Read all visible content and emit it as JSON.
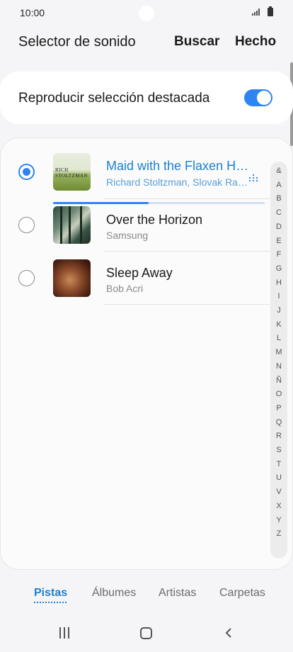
{
  "status_bar": {
    "time": "10:00"
  },
  "header": {
    "title": "Selector de sonido",
    "search_label": "Buscar",
    "done_label": "Hecho"
  },
  "highlight": {
    "label": "Reproducir selección destacada",
    "enabled": true
  },
  "tracks": [
    {
      "title": "Maid with the Flaxen H…",
      "artist": "Richard Stoltzman, Slovak Ra…",
      "selected": true,
      "playing": true,
      "progress_percent": 45,
      "cover_text": "RICH STOLTZMAN"
    },
    {
      "title": "Over the Horizon",
      "artist": "Samsung",
      "selected": false,
      "playing": false
    },
    {
      "title": "Sleep Away",
      "artist": "Bob Acri",
      "selected": false,
      "playing": false
    }
  ],
  "index_letters": [
    "&",
    "A",
    "B",
    "C",
    "D",
    "E",
    "F",
    "G",
    "H",
    "I",
    "J",
    "K",
    "L",
    "M",
    "N",
    "Ñ",
    "O",
    "P",
    "Q",
    "R",
    "S",
    "T",
    "U",
    "V",
    "X",
    "Y",
    "Z"
  ],
  "tabs": [
    {
      "label": "Pistas",
      "active": true
    },
    {
      "label": "Álbumes",
      "active": false
    },
    {
      "label": "Artistas",
      "active": false
    },
    {
      "label": "Carpetas",
      "active": false
    }
  ],
  "colors": {
    "accent": "#2f84f4",
    "active_text": "#1d7fd0"
  },
  "icons": {
    "signal": "signal-icon",
    "battery": "battery-icon",
    "playing": "equalizer-icon",
    "recent": "recent-apps-icon",
    "home": "home-icon",
    "back": "back-icon"
  }
}
